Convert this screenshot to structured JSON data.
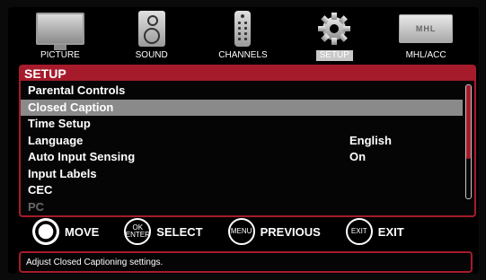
{
  "categories": [
    {
      "label": "PICTURE",
      "icon": "tv-icon"
    },
    {
      "label": "SOUND",
      "icon": "speaker-icon"
    },
    {
      "label": "CHANNELS",
      "icon": "remote-icon"
    },
    {
      "label": "SETUP",
      "icon": "gear-icon",
      "active": true
    },
    {
      "label": "MHL/ACC",
      "icon": "mhl-icon",
      "badge": "MHL"
    }
  ],
  "panel": {
    "title": "SETUP",
    "items": [
      {
        "label": "Parental Controls",
        "value": ""
      },
      {
        "label": "Closed Caption",
        "value": "",
        "selected": true
      },
      {
        "label": "Time Setup",
        "value": ""
      },
      {
        "label": "Language",
        "value": "English"
      },
      {
        "label": "Auto Input Sensing",
        "value": "On"
      },
      {
        "label": "Input Labels",
        "value": ""
      },
      {
        "label": "CEC",
        "value": ""
      },
      {
        "label": "PC",
        "value": "",
        "disabled": true
      }
    ]
  },
  "hints": [
    {
      "button": "",
      "label": "MOVE",
      "icon": "dpad-icon"
    },
    {
      "button": "OK ENTER",
      "label": "SELECT",
      "icon": "ok-enter-button-icon"
    },
    {
      "button": "MENU",
      "label": "PREVIOUS",
      "icon": "menu-button-icon"
    },
    {
      "button": "EXIT",
      "label": "EXIT",
      "icon": "exit-button-icon"
    }
  ],
  "help": "Adjust Closed Captioning settings.",
  "colors": {
    "accent": "#a61b2b",
    "selected": "#8a8a8a",
    "active_tab": "#c8c8c8"
  }
}
